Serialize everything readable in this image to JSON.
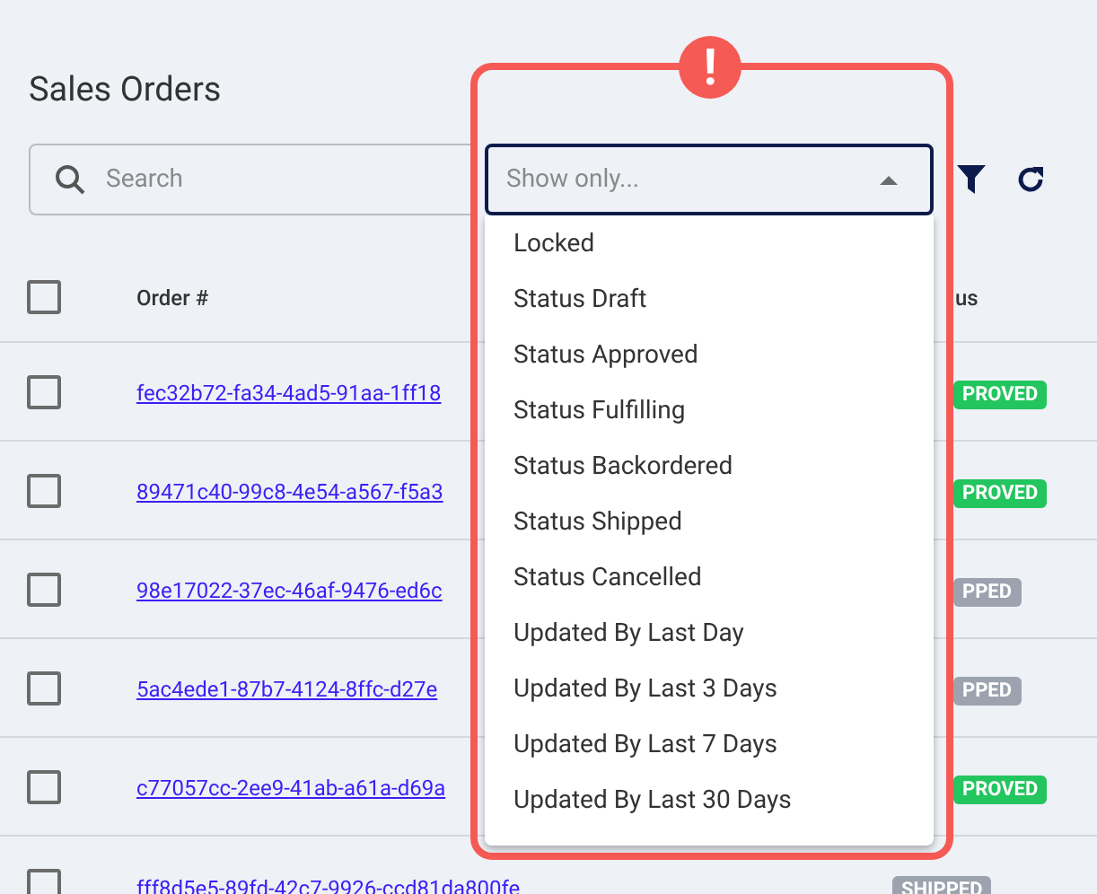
{
  "title": "Sales Orders",
  "search": {
    "placeholder": "Search"
  },
  "filter_select": {
    "placeholder": "Show only...",
    "expanded": true
  },
  "table": {
    "columns": [
      "Order #",
      "us"
    ],
    "all_checked": false,
    "rows": [
      {
        "order": "fec32b72-fa34-4ad5-91aa-1ff18",
        "status": "PROVED",
        "color": "#22c55e",
        "checked": false
      },
      {
        "order": "89471c40-99c8-4e54-a567-f5a3",
        "status": "PROVED",
        "color": "#22c55e",
        "checked": false
      },
      {
        "order": "98e17022-37ec-46af-9476-ed6c",
        "status": "PPED",
        "color": "#9ca3af",
        "checked": false
      },
      {
        "order": "5ac4ede1-87b7-4124-8ffc-d27e",
        "status": "PPED",
        "color": "#9ca3af",
        "checked": false
      },
      {
        "order": "c77057cc-2ee9-41ab-a61a-d69a",
        "status": "PROVED",
        "color": "#22c55e",
        "checked": false
      },
      {
        "order": "fff8d5e5-89fd-42c7-9926-ccd81da800fe",
        "status": "SHIPPED",
        "color": "#9ca3af",
        "checked": false
      }
    ]
  },
  "menu": [
    "Locked",
    "Status Draft",
    "Status Approved",
    "Status Fulfilling",
    "Status Backordered",
    "Status Shipped",
    "Status Cancelled",
    "Updated By Last Day",
    "Updated By Last 3 Days",
    "Updated By Last 7 Days",
    "Updated By Last 30 Days"
  ],
  "alert": {
    "mark": "!"
  }
}
